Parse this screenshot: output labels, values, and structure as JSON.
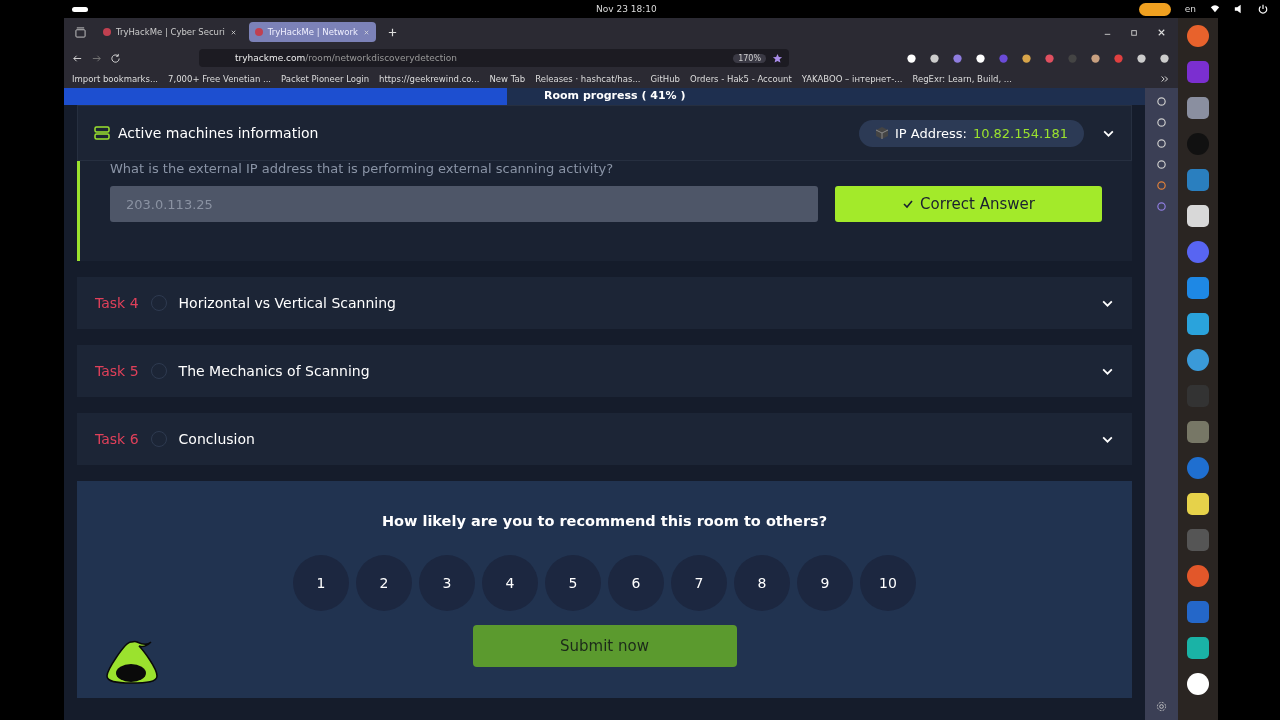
{
  "system_bar": {
    "clock": "Nov 23  18:10",
    "language": "en"
  },
  "tabs": [
    {
      "title": "TryHackMe | Cyber Securi",
      "selected": false
    },
    {
      "title": "TryHackMe | Network",
      "selected": true
    }
  ],
  "address_bar": {
    "domain": "tryhackme.com",
    "path": "/room/networkdiscoverydetection",
    "zoom": "170%"
  },
  "bookmarks": [
    "Import bookmarks...",
    "7,000+ Free Venetian ...",
    "Packet Pioneer Login",
    "https://geekrewind.co...",
    "New Tab",
    "Releases · hashcat/has...",
    "GitHub",
    "Orders - Hak5 - Account",
    "YAKABOO – інтернет-...",
    "RegExr: Learn, Build, ..."
  ],
  "room_progress": {
    "label": "Room progress ( 41% )",
    "level": 0.41
  },
  "machines": {
    "title": "Active machines information",
    "ip_label": "IP Address:",
    "ip": "10.82.154.181"
  },
  "question": {
    "text": "What is the external IP address that is performing external scanning activity?",
    "answer": "203.0.113.25",
    "button": "Correct Answer"
  },
  "tasks": [
    {
      "number": "Task 4",
      "title": "Horizontal vs Vertical Scanning",
      "completed": false
    },
    {
      "number": "Task 5",
      "title": "The Mechanics of Scanning",
      "completed": false
    },
    {
      "number": "Task 6",
      "title": "Conclusion",
      "completed": false
    }
  ],
  "feedback": {
    "question": "How likely are you to recommend this room to others?",
    "options": [
      {
        "label": "1",
        "selected": false
      },
      {
        "label": "2",
        "selected": false
      },
      {
        "label": "3",
        "selected": false
      },
      {
        "label": "4",
        "selected": false
      },
      {
        "label": "5",
        "selected": false
      },
      {
        "label": "6",
        "selected": false
      },
      {
        "label": "7",
        "selected": false
      },
      {
        "label": "8",
        "selected": false
      },
      {
        "label": "9",
        "selected": false
      },
      {
        "label": "10",
        "selected": false
      }
    ],
    "submit": "Submit now"
  }
}
